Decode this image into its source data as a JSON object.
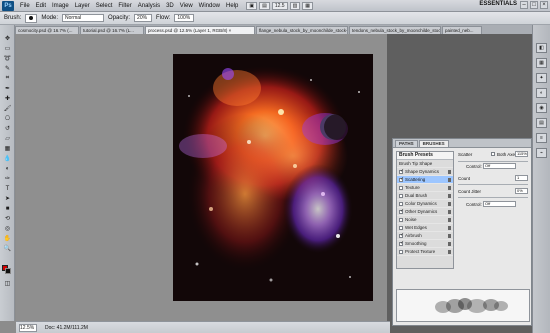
{
  "app": {
    "logo": "Ps",
    "menu": [
      "File",
      "Edit",
      "Image",
      "Layer",
      "Select",
      "Filter",
      "Analysis",
      "3D",
      "View",
      "Window",
      "Help"
    ],
    "toolbar_small": [
      "▣",
      "▤",
      "12.5",
      "▥",
      "▦"
    ],
    "workspace": "ESSENTIALS",
    "window_controls": [
      "–",
      "□",
      "×"
    ]
  },
  "options": {
    "brush_label": "Brush:",
    "mode_label": "Mode:",
    "mode_value": "Normal",
    "opacity_label": "Opacity:",
    "opacity_value": "20%",
    "flow_label": "Flow:",
    "flow_value": "100%"
  },
  "tabs": [
    "cosmocity.psd @ 16.7% (...",
    "tutorial.psd @ 16.7% (L...",
    "process.psd @ 12.5% (Layer 1, RGB/8) ×",
    "flange_nebula_stock_by_moonchilde_stock-d3lo...",
    "tendons_nebula_stock_by_moonchilde_stock-d3zy...",
    "painted_neb..."
  ],
  "status": {
    "zoom": "12.5%",
    "doc": "Doc: 41.2M/111.2M"
  },
  "panel": {
    "tab_paths": "PATHS",
    "tab_brushes": "BRUSHES",
    "brush_presets": "Brush Presets",
    "brush_tip_shape": "Brush Tip Shape",
    "items": [
      {
        "label": "Shape Dynamics",
        "checked": true
      },
      {
        "label": "Scattering",
        "checked": true,
        "active": true
      },
      {
        "label": "Texture",
        "checked": false
      },
      {
        "label": "Dual Brush",
        "checked": false
      },
      {
        "label": "Color Dynamics",
        "checked": false
      },
      {
        "label": "Other Dynamics",
        "checked": true
      },
      {
        "label": "Noise",
        "checked": false
      },
      {
        "label": "Wet Edges",
        "checked": false
      },
      {
        "label": "Airbrush",
        "checked": true
      },
      {
        "label": "Smoothing",
        "checked": true
      },
      {
        "label": "Protect Texture",
        "checked": false
      }
    ],
    "scatter_label": "Scatter",
    "both_axes_label": "Both Axes",
    "scatter_value": "115%",
    "control_label": "Control:",
    "control_value": "Off",
    "count_label": "Count",
    "count_value": "1",
    "count_jitter_label": "Count Jitter",
    "count_jitter_value": "0%",
    "control2_value": "Off"
  },
  "colors": {
    "foreground": "#d00000",
    "background": "#111111"
  }
}
